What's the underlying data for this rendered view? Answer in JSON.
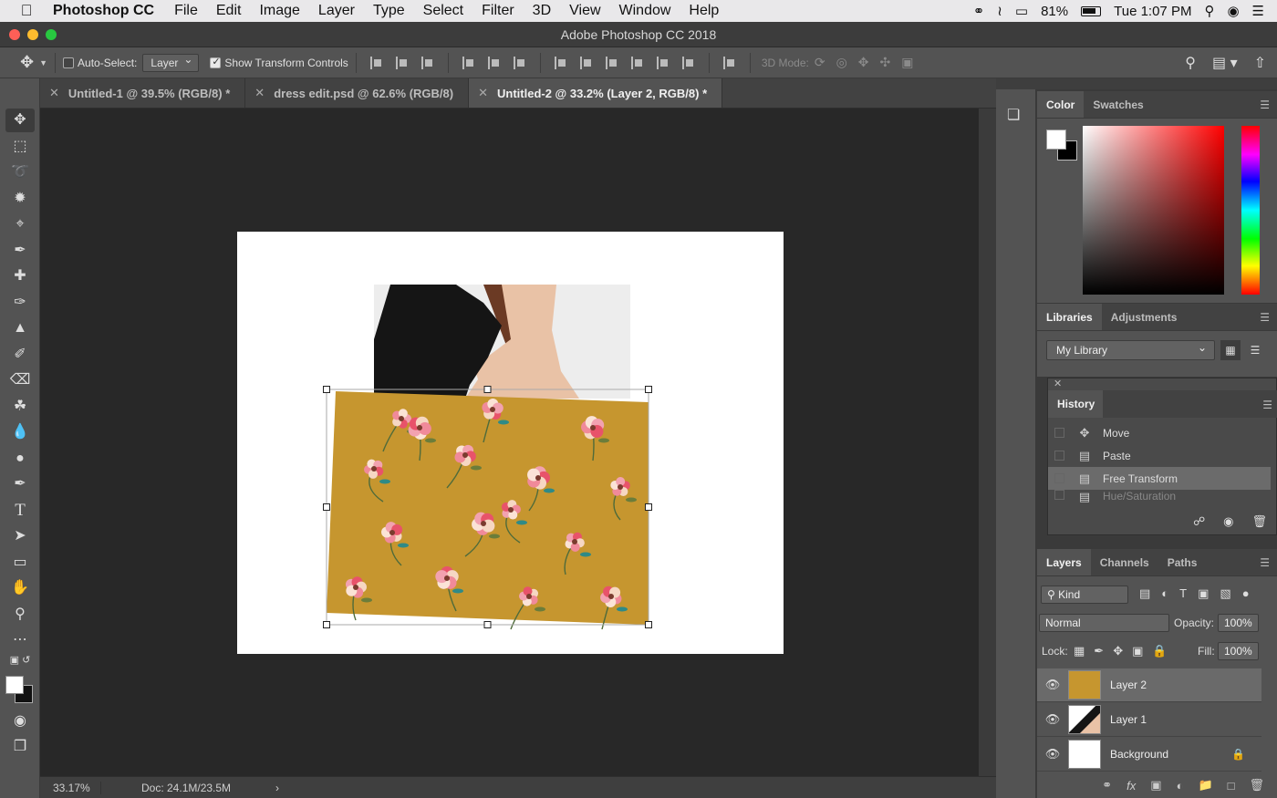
{
  "menubar": {
    "app_name": "Photoshop CC",
    "items": [
      "File",
      "Edit",
      "Image",
      "Layer",
      "Type",
      "Select",
      "Filter",
      "3D",
      "View",
      "Window",
      "Help"
    ],
    "battery": "81%",
    "clock": "Tue 1:07 PM"
  },
  "window": {
    "title": "Adobe Photoshop CC 2018"
  },
  "options": {
    "auto_select_label": "Auto-Select:",
    "auto_select_checked": false,
    "auto_select_target": "Layer",
    "show_transform_label": "Show Transform Controls",
    "show_transform_checked": true,
    "mode_3d_label": "3D Mode:"
  },
  "tabs": [
    {
      "label": "Untitled-1 @ 39.5% (RGB/8) *",
      "active": false
    },
    {
      "label": "dress edit.psd @ 62.6% (RGB/8)",
      "active": false
    },
    {
      "label": "Untitled-2 @ 33.2% (Layer 2, RGB/8) *",
      "active": true
    }
  ],
  "status": {
    "zoom": "33.17%",
    "doc": "Doc: 24.1M/23.5M"
  },
  "color_panel": {
    "tabs": [
      "Color",
      "Swatches"
    ],
    "foreground": "#ffffff",
    "background": "#000000",
    "hue": "#ff0000"
  },
  "libraries_panel": {
    "tabs": [
      "Libraries",
      "Adjustments"
    ],
    "library": "My Library"
  },
  "history_panel": {
    "title": "History",
    "items": [
      {
        "label": "Move",
        "icon": "move-icon",
        "selected": false
      },
      {
        "label": "Paste",
        "icon": "document-icon",
        "selected": false
      },
      {
        "label": "Free Transform",
        "icon": "document-icon",
        "selected": true
      },
      {
        "label": "Hue/Saturation",
        "icon": "document-icon",
        "selected": false
      }
    ]
  },
  "layers_panel": {
    "tabs": [
      "Layers",
      "Channels",
      "Paths"
    ],
    "kind_filter": "Kind",
    "blend_mode": "Normal",
    "opacity_label": "Opacity:",
    "opacity": "100%",
    "lock_label": "Lock:",
    "fill_label": "Fill:",
    "fill": "100%",
    "layers": [
      {
        "name": "Layer 2",
        "selected": true,
        "visible": true,
        "locked": false
      },
      {
        "name": "Layer 1",
        "selected": false,
        "visible": true,
        "locked": false
      },
      {
        "name": "Background",
        "selected": false,
        "visible": true,
        "locked": true
      }
    ]
  },
  "artwork": {
    "fabric_color": "#c6962f",
    "shirt_color": "#151515",
    "hair_color": "#6b3a24",
    "skin_color": "#e9c2a6"
  }
}
